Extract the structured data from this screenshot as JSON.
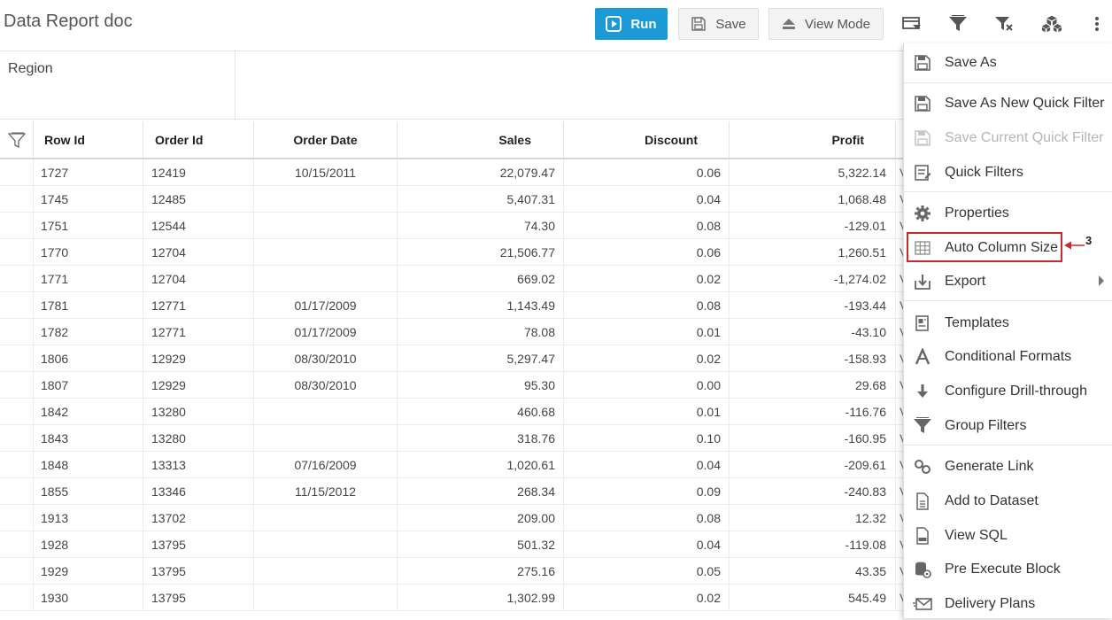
{
  "header": {
    "title": "Data Report doc",
    "run_label": "Run",
    "save_label": "Save",
    "view_mode_label": "View Mode"
  },
  "filter_panel": {
    "region_label": "Region"
  },
  "grid": {
    "columns": [
      "Row Id",
      "Order Id",
      "Order Date",
      "Sales",
      "Discount",
      "Profit"
    ],
    "extra_column_initial": "V",
    "rows": [
      {
        "row_id": "1727",
        "order_id": "12419",
        "order_date": "10/15/2011",
        "sales": "22,079.47",
        "discount": "0.06",
        "profit": "5,322.14"
      },
      {
        "row_id": "1745",
        "order_id": "12485",
        "order_date": "",
        "sales": "5,407.31",
        "discount": "0.04",
        "profit": "1,068.48"
      },
      {
        "row_id": "1751",
        "order_id": "12544",
        "order_date": "",
        "sales": "74.30",
        "discount": "0.08",
        "profit": "-129.01"
      },
      {
        "row_id": "1770",
        "order_id": "12704",
        "order_date": "",
        "sales": "21,506.77",
        "discount": "0.06",
        "profit": "1,260.51"
      },
      {
        "row_id": "1771",
        "order_id": "12704",
        "order_date": "",
        "sales": "669.02",
        "discount": "0.02",
        "profit": "-1,274.02"
      },
      {
        "row_id": "1781",
        "order_id": "12771",
        "order_date": "01/17/2009",
        "sales": "1,143.49",
        "discount": "0.08",
        "profit": "-193.44"
      },
      {
        "row_id": "1782",
        "order_id": "12771",
        "order_date": "01/17/2009",
        "sales": "78.08",
        "discount": "0.01",
        "profit": "-43.10"
      },
      {
        "row_id": "1806",
        "order_id": "12929",
        "order_date": "08/30/2010",
        "sales": "5,297.47",
        "discount": "0.02",
        "profit": "-158.93"
      },
      {
        "row_id": "1807",
        "order_id": "12929",
        "order_date": "08/30/2010",
        "sales": "95.30",
        "discount": "0.00",
        "profit": "29.68"
      },
      {
        "row_id": "1842",
        "order_id": "13280",
        "order_date": "",
        "sales": "460.68",
        "discount": "0.01",
        "profit": "-116.76"
      },
      {
        "row_id": "1843",
        "order_id": "13280",
        "order_date": "",
        "sales": "318.76",
        "discount": "0.10",
        "profit": "-160.95"
      },
      {
        "row_id": "1848",
        "order_id": "13313",
        "order_date": "07/16/2009",
        "sales": "1,020.61",
        "discount": "0.04",
        "profit": "-209.61"
      },
      {
        "row_id": "1855",
        "order_id": "13346",
        "order_date": "11/15/2012",
        "sales": "268.34",
        "discount": "0.09",
        "profit": "-240.83"
      },
      {
        "row_id": "1913",
        "order_id": "13702",
        "order_date": "",
        "sales": "209.00",
        "discount": "0.08",
        "profit": "12.32"
      },
      {
        "row_id": "1928",
        "order_id": "13795",
        "order_date": "",
        "sales": "501.32",
        "discount": "0.04",
        "profit": "-119.08"
      },
      {
        "row_id": "1929",
        "order_id": "13795",
        "order_date": "",
        "sales": "275.16",
        "discount": "0.05",
        "profit": "43.35"
      },
      {
        "row_id": "1930",
        "order_id": "13795",
        "order_date": "",
        "sales": "1,302.99",
        "discount": "0.02",
        "profit": "545.49"
      }
    ]
  },
  "menu": {
    "save_as": "Save As",
    "save_as_quick_filter": "Save As New Quick Filter",
    "save_current_quick_filter": "Save Current Quick Filter",
    "quick_filters": "Quick Filters",
    "properties": "Properties",
    "auto_column_size": "Auto Column Size",
    "export": "Export",
    "templates": "Templates",
    "conditional_formats": "Conditional Formats",
    "configure_drill_through": "Configure Drill-through",
    "group_filters": "Group Filters",
    "generate_link": "Generate Link",
    "add_to_dataset": "Add to Dataset",
    "view_sql": "View SQL",
    "pre_execute_block": "Pre Execute Block",
    "delivery_plans": "Delivery Plans"
  },
  "annotation": {
    "number": "3"
  },
  "colors": {
    "accent": "#1b9ad6",
    "annotation_red": "#c9282d"
  }
}
